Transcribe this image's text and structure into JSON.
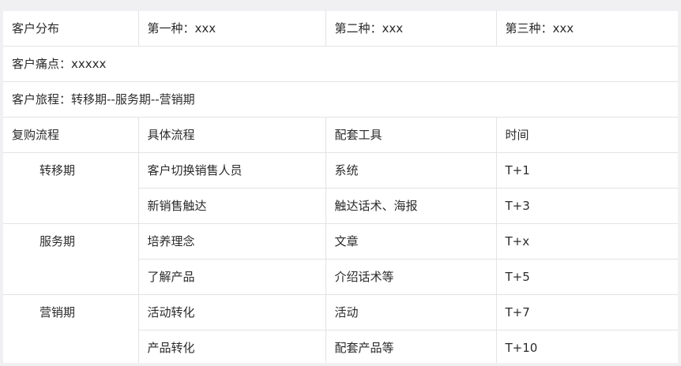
{
  "summary": {
    "distribution_label": "客户分布",
    "types": [
      "第一种：xxx",
      "第二种：xxx",
      "第三种：xxx"
    ],
    "pain_points": "客户痛点：xxxxx",
    "journey": "客户旅程：转移期--服务期--营销期"
  },
  "process_table": {
    "headers": [
      "复购流程",
      "具体流程",
      "配套工具",
      "时间"
    ],
    "phases": [
      {
        "name": "转移期",
        "steps": [
          {
            "process": "客户切换销售人员",
            "tool": "系统",
            "time": "T+1"
          },
          {
            "process": "新销售触达",
            "tool": "触达话术、海报",
            "time": "T+3"
          }
        ]
      },
      {
        "name": "服务期",
        "steps": [
          {
            "process": "培养理念",
            "tool": "文章",
            "time": "T+x"
          },
          {
            "process": "了解产品",
            "tool": "介绍话术等",
            "time": "T+5"
          }
        ]
      },
      {
        "name": "营销期",
        "steps": [
          {
            "process": "活动转化",
            "tool": "活动",
            "time": "T+7"
          },
          {
            "process": "产品转化",
            "tool": "配套产品等",
            "time": "T+10"
          }
        ]
      }
    ]
  }
}
